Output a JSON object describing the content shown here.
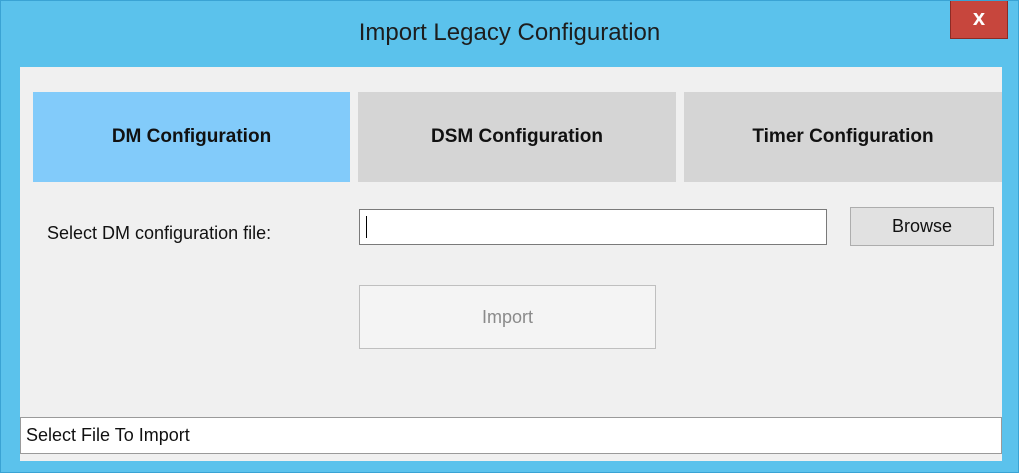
{
  "window": {
    "title": "Import Legacy Configuration",
    "close_label": "x",
    "frame_color": "#5bc2ec",
    "close_color": "#c7463d"
  },
  "tabs": [
    {
      "label": "DM Configuration",
      "active": true
    },
    {
      "label": "DSM Configuration",
      "active": false
    },
    {
      "label": "Timer Configuration",
      "active": false
    }
  ],
  "colors": {
    "active_tab": "#82cbfa",
    "inactive_tab": "#d5d5d5"
  },
  "form": {
    "file_label": "Select DM configuration file:",
    "file_value": "",
    "browse_label": "Browse",
    "import_label": "Import",
    "import_enabled": false
  },
  "status": {
    "text": "Select File To Import"
  }
}
